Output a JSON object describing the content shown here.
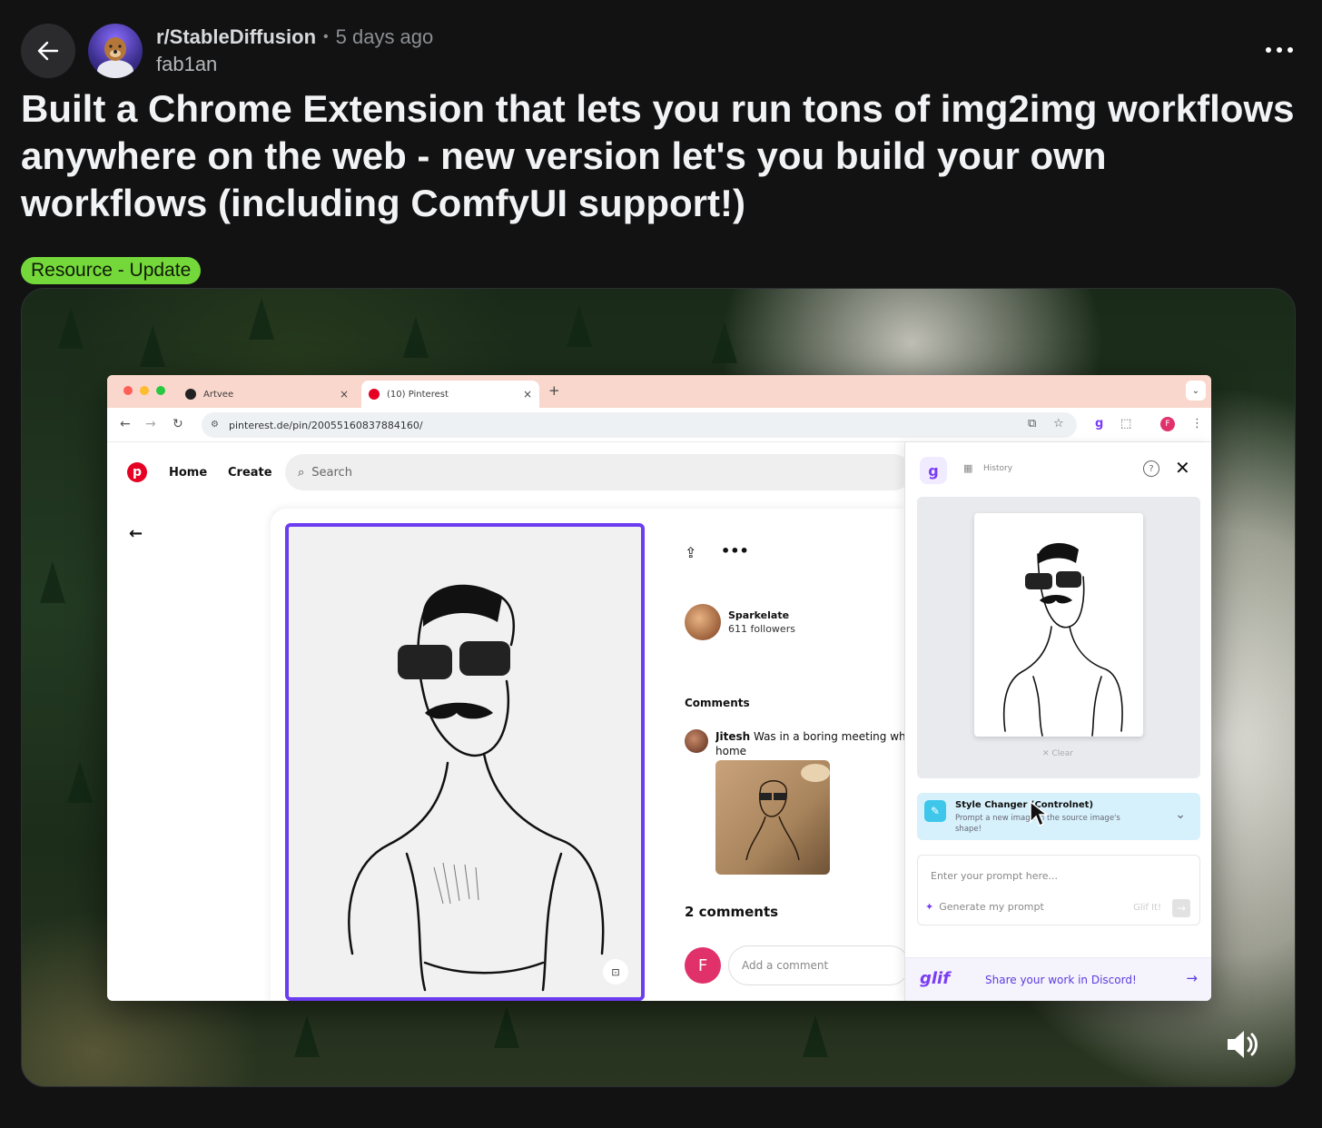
{
  "post": {
    "subreddit": "r/StableDiffusion",
    "separator": "•",
    "time": "5 days ago",
    "author": "fab1an",
    "title": "Built a Chrome Extension that lets you run tons of img2img workflows anywhere on the web - new version let's you build your own workflows (including ComfyUI support!)",
    "flair": "Resource - Update"
  },
  "colors": {
    "flair_bg": "#75d83a",
    "accent_purple": "#7a3cf4",
    "pinterest_red": "#e60023"
  },
  "browser": {
    "tabs": [
      {
        "label": "Artvee",
        "close": "×"
      },
      {
        "label": "(10) Pinterest",
        "close": "×"
      }
    ],
    "new_tab": "+",
    "url": "pinterest.de/pin/20055160837884160/"
  },
  "pinterest": {
    "logo": "p",
    "nav": [
      "Home",
      "Create"
    ],
    "search_placeholder": "Search",
    "creator": {
      "name": "Sparkelate",
      "followers": "611 followers"
    },
    "comments_heading": "Comments",
    "comment": {
      "user": "Jitesh",
      "text": "Was in a boring meeting wh",
      "text2": "home"
    },
    "comment_count": "2 comments",
    "my_initial": "F",
    "add_comment_placeholder": "Add a comment"
  },
  "glif_panel": {
    "logo": "g",
    "history": "History",
    "clear": "✕ Clear",
    "style_name": "Style Changer (Controlnet)",
    "style_desc": "Prompt a new image in the source image's shape!",
    "prompt_placeholder": "Enter your prompt here...",
    "generate": "Generate my prompt",
    "glif_it": "Glif It!",
    "brand": "glif",
    "discord": "Share your work in Discord!"
  }
}
